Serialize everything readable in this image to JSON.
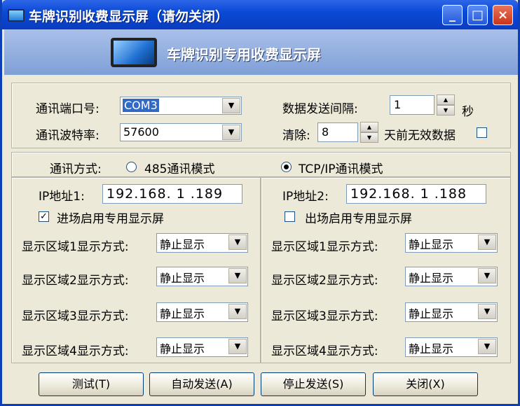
{
  "window": {
    "title": "车牌识别收费显示屏（请勿关闭）",
    "banner_title": "车牌识别专用收费显示屏",
    "controls": {
      "minimize": "_",
      "maximize": "□",
      "close": "×"
    }
  },
  "comm": {
    "port_label": "通讯端口号:",
    "port_value": "COM3",
    "baud_label": "通讯波特率:",
    "baud_value": "57600",
    "interval_label": "数据发送间隔:",
    "interval_value": "1",
    "interval_unit": "秒",
    "clear_label": "清除:",
    "clear_value": "8",
    "clear_suffix": "天前无效数据",
    "clear_checked": false
  },
  "mode": {
    "label": "通讯方式:",
    "options": [
      "485通讯模式",
      "TCP/IP通讯模式"
    ],
    "selected": "TCP/IP通讯模式"
  },
  "entry": {
    "ip_label": "IP地址1:",
    "ip_value": "192.168.  1 .189",
    "enable_label": "进场启用专用显示屏",
    "enabled": true,
    "zones": [
      {
        "label": "显示区域1显示方式:",
        "value": "静止显示"
      },
      {
        "label": "显示区域2显示方式:",
        "value": "静止显示"
      },
      {
        "label": "显示区域3显示方式:",
        "value": "静止显示"
      },
      {
        "label": "显示区域4显示方式:",
        "value": "静止显示"
      }
    ]
  },
  "exit": {
    "ip_label": "IP地址2:",
    "ip_value": "192.168.  1 .188",
    "enable_label": "出场启用专用显示屏",
    "enabled": false,
    "zones": [
      {
        "label": "显示区域1显示方式:",
        "value": "静止显示"
      },
      {
        "label": "显示区域2显示方式:",
        "value": "静止显示"
      },
      {
        "label": "显示区域3显示方式:",
        "value": "静止显示"
      },
      {
        "label": "显示区域4显示方式:",
        "value": "静止显示"
      }
    ]
  },
  "buttons": {
    "test": "测试(T)",
    "auto_send": "自动发送(A)",
    "stop_send": "停止发送(S)",
    "close": "关闭(X)"
  },
  "icons": {
    "combo_arrow": "▼",
    "spin_up": "▲",
    "spin_down": "▼",
    "check": "✓"
  },
  "colors": {
    "titlebar": "#0a4ad6",
    "selection": "#316ac5",
    "face": "#ece9d8"
  }
}
